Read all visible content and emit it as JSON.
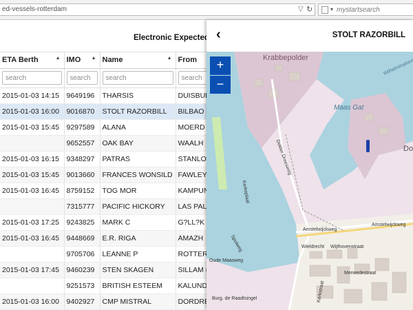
{
  "browser": {
    "url": "ed-vessels-rotterdam",
    "search_placeholder": "mystartsearch"
  },
  "page": {
    "title": "Electronic Expected V"
  },
  "table": {
    "columns": [
      {
        "label": "ETA Berth",
        "filter_placeholder": "search"
      },
      {
        "label": "IMO",
        "filter_placeholder": "search"
      },
      {
        "label": "Name",
        "filter_placeholder": "search"
      },
      {
        "label": "From",
        "filter_placeholder": "search"
      }
    ],
    "rows": [
      {
        "eta": "2015-01-03 14:15",
        "imo": "9649196",
        "name": "THARSIS",
        "from": "DUISBUR",
        "selected": false
      },
      {
        "eta": "2015-01-03 16:00",
        "imo": "9016870",
        "name": "STOLT RAZORBILL",
        "from": "BILBAO (",
        "selected": true
      },
      {
        "eta": "2015-01-03 15:45",
        "imo": "9297589",
        "name": "ALANA",
        "from": "MOERD",
        "selected": false
      },
      {
        "eta": "",
        "imo": "9652557",
        "name": "OAK BAY",
        "from": "WAALH",
        "selected": false
      },
      {
        "eta": "2015-01-03 16:15",
        "imo": "9348297",
        "name": "PATRAS",
        "from": "STANLO",
        "selected": false
      },
      {
        "eta": "2015-01-03 15:45",
        "imo": "9013660",
        "name": "FRANCES WONSILD",
        "from": "FAWLEY",
        "selected": false
      },
      {
        "eta": "2015-01-03 16:45",
        "imo": "8759152",
        "name": "TOG MOR",
        "from": "KAMPUN",
        "selected": false
      },
      {
        "eta": "",
        "imo": "7315777",
        "name": "PACIFIC HICKORY",
        "from": "LAS PAL",
        "selected": false
      },
      {
        "eta": "2015-01-03 17:25",
        "imo": "9243825",
        "name": "MARK C",
        "from": "G?LL?K",
        "selected": false
      },
      {
        "eta": "2015-01-03 16:45",
        "imo": "9448669",
        "name": "E.R. RIGA",
        "from": "AMAZH",
        "selected": false
      },
      {
        "eta": "",
        "imo": "9705706",
        "name": "LEANNE P",
        "from": "ROTTER",
        "selected": false
      },
      {
        "eta": "2015-01-03 17:45",
        "imo": "9460239",
        "name": "STEN SKAGEN",
        "from": "SILLAM (",
        "selected": false
      },
      {
        "eta": "",
        "imo": "9251573",
        "name": "BRITISH ESTEEM",
        "from": "KALUND",
        "selected": false
      },
      {
        "eta": "2015-01-03 16:00",
        "imo": "9402927",
        "name": "CMP MISTRAL",
        "from": "DORDRE",
        "selected": false
      }
    ]
  },
  "panel": {
    "back_icon": "chevron-left-icon",
    "title": "STOLT RAZORBILL",
    "zoom_in": "+",
    "zoom_out": "−"
  },
  "map": {
    "water_color": "#aad3df",
    "land_color": "#efe2ea",
    "industrial_color": "#dcc6d3",
    "vessel_color": "#1b3fa8",
    "labels": {
      "district": "Krabbepolder",
      "harbour": "Maas Gat",
      "harbour_east": "Wilhelminahaven",
      "street1": "Amstelwijckweg",
      "street2": "Amstelwijckweg",
      "street3": "Wieldrecht",
      "street4": "Wijthovenstraat",
      "street5": "Dokter Dreesweg",
      "street6": "Merwedestraat",
      "street7": "Kerkeplaat",
      "street8": "Oude Maasweg",
      "street9": "Kerkstraat",
      "street10": "Burg. de Raadtsingel",
      "street11": "Spuiweg",
      "dock": "Do"
    }
  }
}
